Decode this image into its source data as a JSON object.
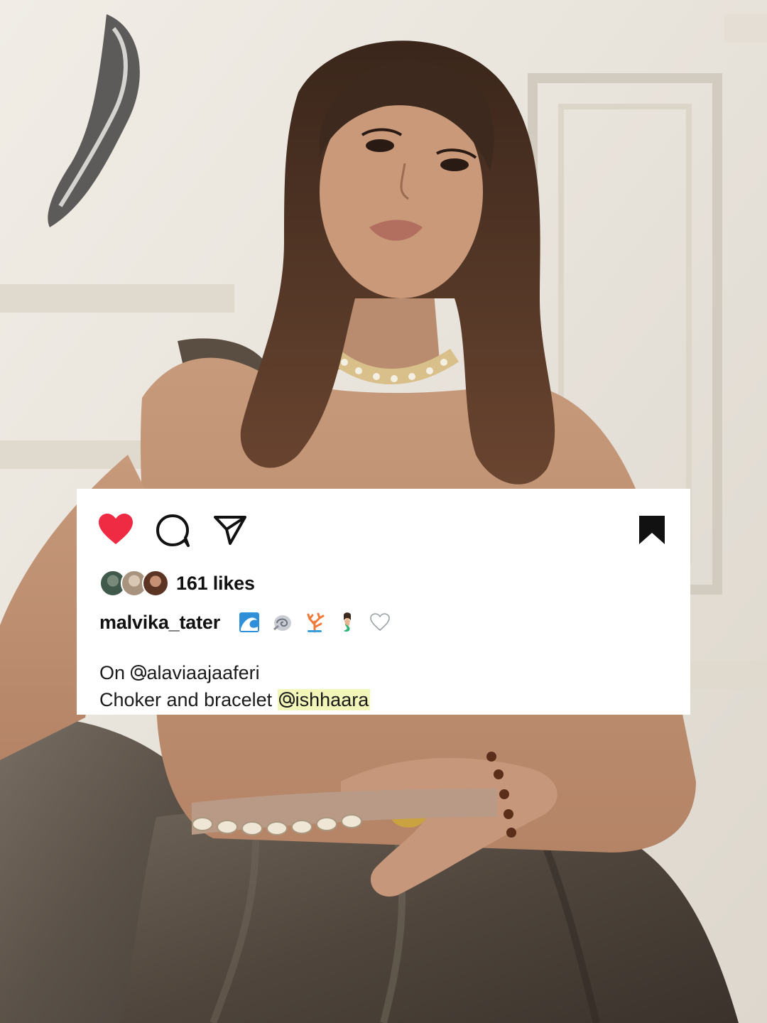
{
  "post": {
    "likes_label": "161 likes",
    "username": "malvika_tater",
    "username_emojis": [
      "water-wave-emoji",
      "spiral-shell-emoji",
      "coral-emoji",
      "mermaid-emoji",
      "white-heart-emoji"
    ],
    "caption": {
      "line1_prefix": "On ",
      "line1_mention": "alaviaajaaferi",
      "line2_prefix": "Choker and bracelet ",
      "line2_mention": "ishhaara"
    },
    "liked": true,
    "saved": true
  },
  "icons": {
    "like": "heart-icon",
    "comment": "comment-bubble-icon",
    "share": "paper-plane-icon",
    "save": "bookmark-icon",
    "mention": "threads-at-icon"
  },
  "colors": {
    "heart": "#ef2b44",
    "text": "#111111",
    "mention_highlight": "#f2f6b8",
    "card_bg": "#ffffff"
  }
}
